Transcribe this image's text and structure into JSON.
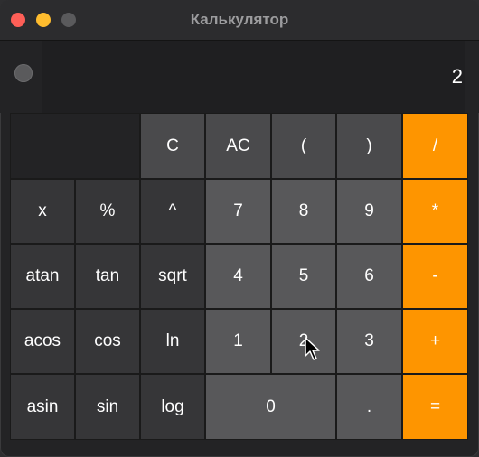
{
  "window": {
    "title": "Калькулятор"
  },
  "display": {
    "value": "2"
  },
  "keys": {
    "clear": "C",
    "all_clear": "AC",
    "lparen": "(",
    "rparen": ")",
    "divide": "/",
    "x": "x",
    "percent": "%",
    "power": "^",
    "seven": "7",
    "eight": "8",
    "nine": "9",
    "multiply": "*",
    "atan": "atan",
    "tan": "tan",
    "sqrt": "sqrt",
    "four": "4",
    "five": "5",
    "six": "6",
    "minus": "-",
    "acos": "acos",
    "cos": "cos",
    "ln": "ln",
    "one": "1",
    "two": "2",
    "three": "3",
    "plus": "+",
    "asin": "asin",
    "sin": "sin",
    "log": "log",
    "zero": "0",
    "dot": ".",
    "equals": "="
  },
  "colors": {
    "accent": "#fe9500",
    "button_dark": "#363638",
    "button_mid": "#4a4a4c",
    "button_number": "#58585a"
  }
}
